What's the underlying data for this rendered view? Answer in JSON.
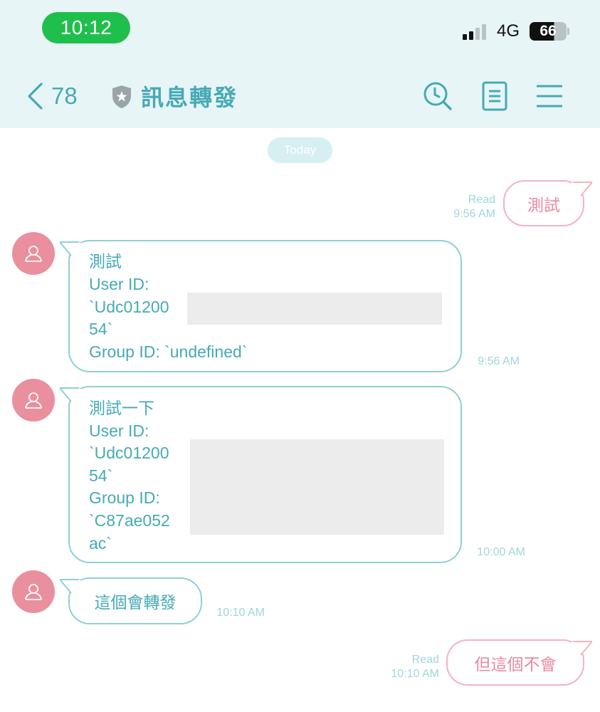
{
  "status_bar": {
    "time": "10:12",
    "network": "4G",
    "battery": "66"
  },
  "header": {
    "back_count": "78",
    "title": "訊息轉發",
    "icons": [
      "shield-icon",
      "search-icon",
      "notes-icon",
      "menu-icon"
    ]
  },
  "chat": {
    "date_label": "Today",
    "messages": [
      {
        "direction": "out",
        "text": "測試",
        "status": "Read",
        "time": "9:56 AM"
      },
      {
        "direction": "in",
        "lines": [
          "測試",
          "User ID:",
          "`Udc01200",
          "54`",
          "Group ID: `undefined`"
        ],
        "time": "9:56 AM"
      },
      {
        "direction": "in",
        "lines": [
          "測試一下",
          "User ID:",
          "`Udc01200",
          "54`",
          "Group ID:",
          "`C87ae052",
          "ac`"
        ],
        "time": "10:00 AM"
      },
      {
        "direction": "in",
        "text": "這個會轉發",
        "time": "10:10 AM"
      },
      {
        "direction": "out",
        "text": "但這個不會",
        "status": "Read",
        "time": "10:10 AM"
      }
    ]
  },
  "colors": {
    "accent": "#45aab6",
    "header_bg": "#e8f5f6",
    "incoming_border": "#8fd0d6",
    "outgoing_border": "#f2b3c1",
    "outgoing_text": "#e98aa0",
    "avatar": "#e98f9e",
    "status_time_pill": "#1fbf4c"
  }
}
